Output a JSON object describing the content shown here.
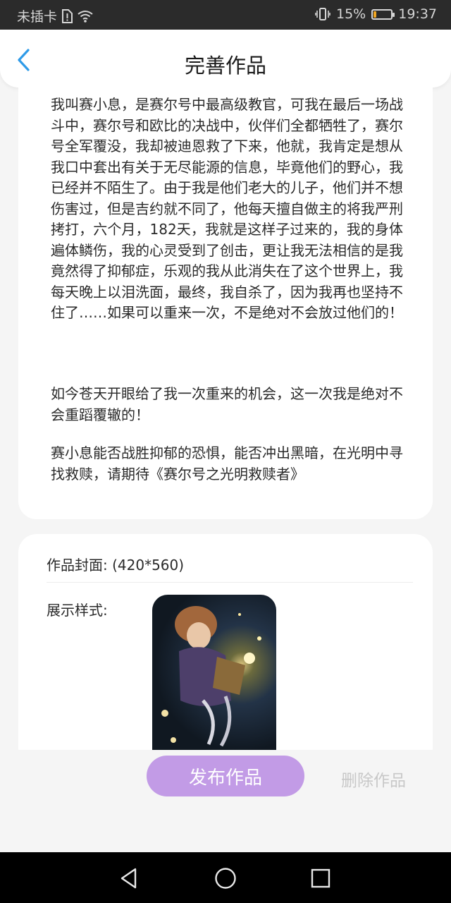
{
  "status_bar": {
    "carrier": "未插卡",
    "battery_percent": "15%",
    "battery_level": 0.15,
    "time": "19:37",
    "icons": [
      "sim-alert-icon",
      "wifi-icon",
      "vibrate-icon",
      "battery-icon"
    ]
  },
  "header": {
    "title": "完善作品",
    "back_icon": "chevron-left-icon"
  },
  "description": {
    "paragraphs": [
      "我叫赛小息，是赛尔号中最高级教官，可我在最后一场战斗中，赛尔号和欧比的决战中，伙伴们全都牺牲了，赛尔号全军覆没，我却被迪恩救了下来，他就，我肯定是想从我口中套出有关于无尽能源的信息，毕竟他们的野心，我已经并不陌生了。由于我是他们老大的儿子，他们并不想伤害过，但是吉约就不同了，他每天擅自做主的将我严刑拷打，六个月，182天，我就是这样子过来的，我的身体遍体鳞伤，我的心灵受到了创击，更让我无法相信的是我竟然得了抑郁症，乐观的我从此消失在了这个世界上，我每天晚上以泪洗面，最终，我自杀了，因为我再也坚持不住了……如果可以重来一次，不是绝对不会放过他们的！",
      "如今苍天开眼给了我一次重来的机会，这一次我是绝对不会重蹈覆辙的！",
      "赛小息能否战胜抑郁的恐惧，能否冲出黑暗，在光明中寻找救赎，请期待《赛尔号之光明救赎者》"
    ]
  },
  "cover": {
    "label": "作品封面: (420*560)",
    "style_label": "展示样式:"
  },
  "actions": {
    "publish_label": "发布作品",
    "delete_label": "删除作品"
  },
  "colors": {
    "accent": "#c29be6",
    "back_arrow": "#2f9be8",
    "battery": "#f0a623"
  },
  "nav": {
    "icons": [
      "back-triangle-icon",
      "home-circle-icon",
      "recents-square-icon"
    ]
  }
}
